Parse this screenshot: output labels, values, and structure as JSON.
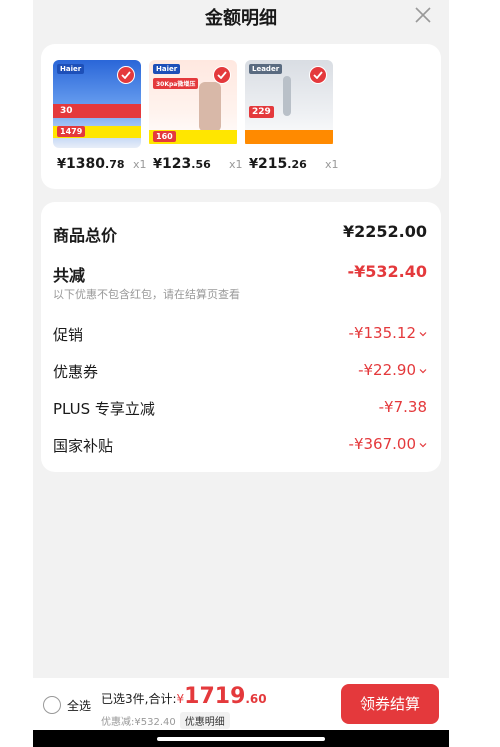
{
  "header": {
    "title": "金额明细"
  },
  "products": [
    {
      "price_yuan": "¥",
      "price_int": "1380",
      "price_dec": ".78",
      "qty": "x1",
      "thumb": {
        "brand": "Haier",
        "promo": "30",
        "price": "1479"
      }
    },
    {
      "price_yuan": "¥",
      "price_int": "123",
      "price_dec": ".56",
      "qty": "x1",
      "thumb": {
        "brand": "Haier",
        "promo": "30Kpa微增压",
        "price": "160"
      }
    },
    {
      "price_yuan": "¥",
      "price_int": "215",
      "price_dec": ".26",
      "qty": "x1",
      "thumb": {
        "brand": "Leader",
        "price": "229"
      }
    }
  ],
  "details": {
    "goods_total": {
      "label": "商品总价",
      "value": "¥2252.00"
    },
    "total_reduction": {
      "label": "共减",
      "value": "-¥532.40",
      "note": "以下优惠不包含红包，请在结算页查看"
    },
    "promotion": {
      "label": "促销",
      "value": "-¥135.12"
    },
    "coupon": {
      "label": "优惠券",
      "value": "-¥22.90"
    },
    "plus": {
      "label": "PLUS 专享立减",
      "value": "-¥7.38"
    },
    "subsidy": {
      "label": "国家补贴",
      "value": "-¥367.00"
    }
  },
  "footer": {
    "select_all": "全选",
    "selected_text": "已选3件,合计:",
    "total_yuan": "¥",
    "total_int": "1719",
    "total_dec": ".60",
    "discount_text": "优惠减:¥532.40",
    "detail_chip": "优惠明细",
    "checkout": "领券结算"
  },
  "colors": {
    "accent": "#e4393c",
    "background": "#f2f2f2",
    "card": "#ffffff"
  }
}
